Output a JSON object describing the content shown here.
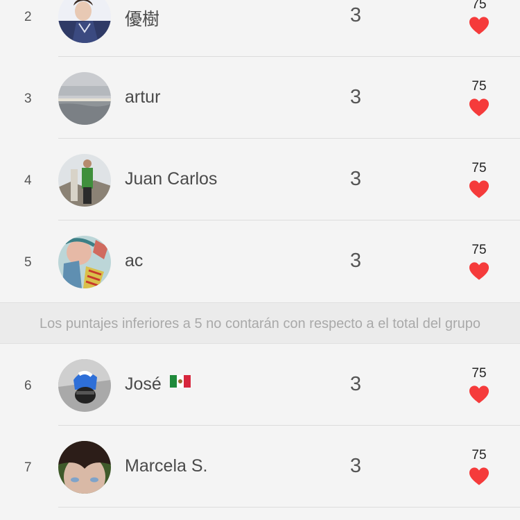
{
  "leaderboard": {
    "rows_top": [
      {
        "rank": "2",
        "name": "優樹",
        "score": "3",
        "likes": "75",
        "avatar": "avatar-1"
      },
      {
        "rank": "3",
        "name": "artur",
        "score": "3",
        "likes": "75",
        "avatar": "avatar-2"
      },
      {
        "rank": "4",
        "name": "Juan Carlos",
        "score": "3",
        "likes": "75",
        "avatar": "avatar-3"
      },
      {
        "rank": "5",
        "name": "ac",
        "score": "3",
        "likes": "75",
        "avatar": "avatar-4"
      }
    ],
    "notice": "Los puntajes inferiores a 5 no contarán con respecto a el total del grupo",
    "rows_bottom": [
      {
        "rank": "6",
        "name": "José",
        "flag": "mexico-flag",
        "score": "3",
        "likes": "75",
        "avatar": "avatar-5"
      },
      {
        "rank": "7",
        "name": "Marcela S.",
        "score": "3",
        "likes": "75",
        "avatar": "avatar-6"
      }
    ]
  },
  "icons": {
    "like": "heart-icon"
  },
  "colors": {
    "heart": "#f53b3b",
    "background": "#f4f4f4",
    "banner_bg": "#ebebeb",
    "banner_text": "#a9a9a9",
    "divider": "#dcdcdc"
  }
}
